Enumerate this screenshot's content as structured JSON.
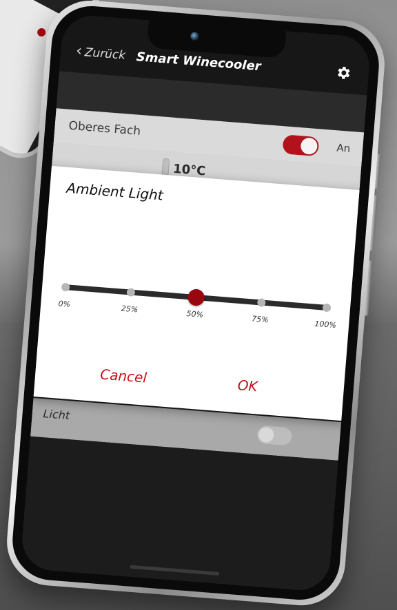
{
  "nav": {
    "back_label": "Zurück",
    "back_icon": "chevron-left-icon",
    "title": "Smart Winecooler",
    "settings_icon": "gear-icon"
  },
  "compartment": {
    "label": "Oberes Fach",
    "toggle_on": true,
    "toggle_state_label": "An",
    "temperature": "10°C"
  },
  "dialog": {
    "title": "Ambient Light",
    "slider": {
      "stops": [
        "0%",
        "25%",
        "50%",
        "75%",
        "100%"
      ],
      "value_percent": 50
    },
    "cancel_label": "Cancel",
    "ok_label": "OK"
  },
  "light": {
    "label": "Licht",
    "toggle_on": false
  },
  "colors": {
    "accent": "#c8101c",
    "thumb": "#9a0610",
    "toggle_on": "#b2121b"
  }
}
